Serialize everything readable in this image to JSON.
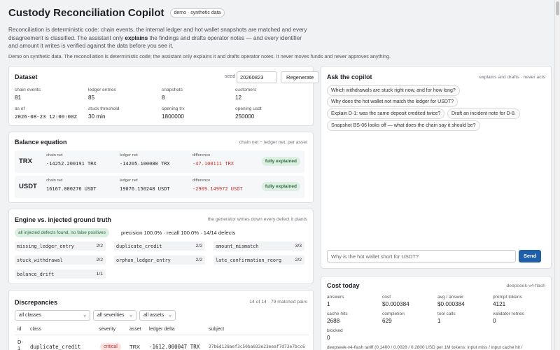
{
  "header": {
    "title": "Custody Reconciliation Copilot",
    "badge": "demo · synthetic data",
    "intro_part1": "Reconciliation is deterministic code: chain events, the internal ledger and hot wallet snapshots are matched and every disagreement is classified. The assistant only ",
    "intro_bold": "explains",
    "intro_part2": " the findings and drafts operator notes — and every identifier and amount it writes is verified against the data before you see it.",
    "note": "Demo on synthetic data. The reconciliation is deterministic code; the assistant only explains it and drafts operator notes. It never moves funds and never approves anything."
  },
  "dataset": {
    "title": "Dataset",
    "seed_label": "seed",
    "seed_value": "20260823",
    "regenerate": "Regenerate",
    "stats": [
      {
        "label": "chain events",
        "value": "81"
      },
      {
        "label": "ledger entries",
        "value": "85"
      },
      {
        "label": "snapshots",
        "value": "8"
      },
      {
        "label": "customers",
        "value": "12"
      },
      {
        "label": "as of",
        "value": "2026-08-23 12:00:00Z"
      },
      {
        "label": "stuck threshold",
        "value": "30 min"
      },
      {
        "label": "opening trx",
        "value": "1800000"
      },
      {
        "label": "opening usdt",
        "value": "250000"
      }
    ]
  },
  "balance": {
    "title": "Balance equation",
    "subtitle": "chain net − ledger net, per asset",
    "col_chain": "chain net",
    "col_ledger": "ledger net",
    "col_diff": "difference",
    "rows": [
      {
        "asset": "TRX",
        "chain": "-14252.200191 TRX",
        "ledger": "-14205.100080 TRX",
        "diff": "-47.100111 TRX",
        "status": "fully explained"
      },
      {
        "asset": "USDT",
        "chain": "16167.000276 USDT",
        "ledger": "19076.150248 USDT",
        "diff": "-2909.149972 USDT",
        "status": "fully explained"
      }
    ]
  },
  "engine": {
    "title": "Engine vs. injected ground truth",
    "subtitle": "the generator writes down every defect it plants",
    "badge": "all injected defects found, no false positives",
    "metrics": "precision 100.0% · recall 100.0% · 14/14 defects",
    "defects": [
      {
        "name": "missing_ledger_entry",
        "count": "2/2"
      },
      {
        "name": "duplicate_credit",
        "count": "2/2"
      },
      {
        "name": "amount_mismatch",
        "count": "3/3"
      },
      {
        "name": "stuck_withdrawal",
        "count": "2/2"
      },
      {
        "name": "orphan_ledger_entry",
        "count": "2/2"
      },
      {
        "name": "late_confirmation_reorg",
        "count": "2/2"
      },
      {
        "name": "balance_drift",
        "count": "1/1"
      }
    ]
  },
  "discrepancies": {
    "title": "Discrepancies",
    "summary": "14 of 14 · 79 matched pairs",
    "filters": [
      "all classes",
      "all severities",
      "all assets"
    ],
    "columns": [
      "id",
      "class",
      "severity",
      "asset",
      "ledger delta",
      "subject"
    ],
    "rows": [
      {
        "id_line1": "D-",
        "id_line2": "1",
        "class": "duplicate_credit",
        "severity": "critical",
        "asset": "TRX",
        "delta": "-1612.000047 TRX",
        "subject": "37b6d128aef3c50ba033e23eeaf7d73e7bcc6"
      }
    ]
  },
  "copilot": {
    "title": "Ask the copilot",
    "subtitle": "explains and drafts · never acts",
    "suggestions": [
      "Which withdrawals are stuck right now, and for how long?",
      "Why does the hot wallet not match the ledger for USDT?",
      "Explain D-1: was the same deposit credited twice?",
      "Draft an incident note for D-8.",
      "Snapshot BS-06 looks off — what does the chain say it should be?"
    ],
    "placeholder": "Why is the hot wallet short for USDT?",
    "send": "Send"
  },
  "cost": {
    "title": "Cost today",
    "model": "deepseek-v4-flash",
    "stats": [
      {
        "label": "answers",
        "value": "1"
      },
      {
        "label": "cost",
        "value": "$0.000384"
      },
      {
        "label": "avg / answer",
        "value": "$0.000384"
      },
      {
        "label": "prompt tokens",
        "value": "4121"
      },
      {
        "label": "cache hits",
        "value": "2688"
      },
      {
        "label": "completion",
        "value": "629"
      },
      {
        "label": "tool calls",
        "value": "1"
      },
      {
        "label": "validator retries",
        "value": "0"
      },
      {
        "label": "blocked",
        "value": "0"
      }
    ],
    "tariff": "deepseek-v4-flash tariff (0.1400 / 0.0028 / 0.2800 USD per 1M tokens: input miss / input cache hit /"
  }
}
